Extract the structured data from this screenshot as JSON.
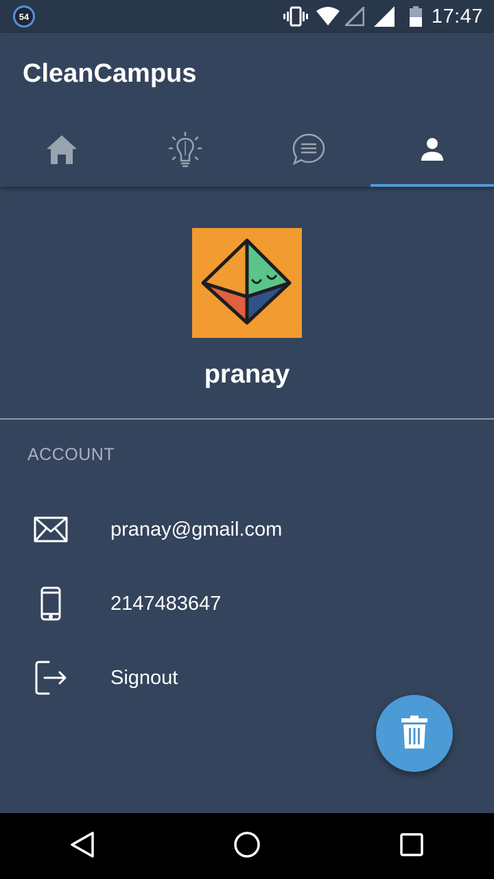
{
  "status_bar": {
    "notification_badge": "54",
    "time": "17:47",
    "icons": [
      "vibrate-icon",
      "wifi-icon",
      "signal-empty-icon",
      "signal-icon",
      "battery-icon"
    ]
  },
  "app_bar": {
    "title": "CleanCampus",
    "tabs": [
      {
        "icon": "home-icon",
        "selected": false
      },
      {
        "icon": "lightbulb-icon",
        "selected": false
      },
      {
        "icon": "chat-icon",
        "selected": false
      },
      {
        "icon": "person-icon",
        "selected": true
      }
    ]
  },
  "profile": {
    "username": "pranay"
  },
  "account": {
    "header": "ACCOUNT",
    "email": "pranay@gmail.com",
    "phone": "2147483647",
    "signout_label": "Signout"
  },
  "fab": {
    "icon": "trash-icon"
  },
  "nav_bar": {
    "buttons": [
      "back-icon",
      "home-circle-icon",
      "recents-icon"
    ]
  },
  "colors": {
    "background": "#34445C",
    "status_bar": "#29374B",
    "accent": "#4C9BD6",
    "avatar_bg": "#F29B30"
  }
}
